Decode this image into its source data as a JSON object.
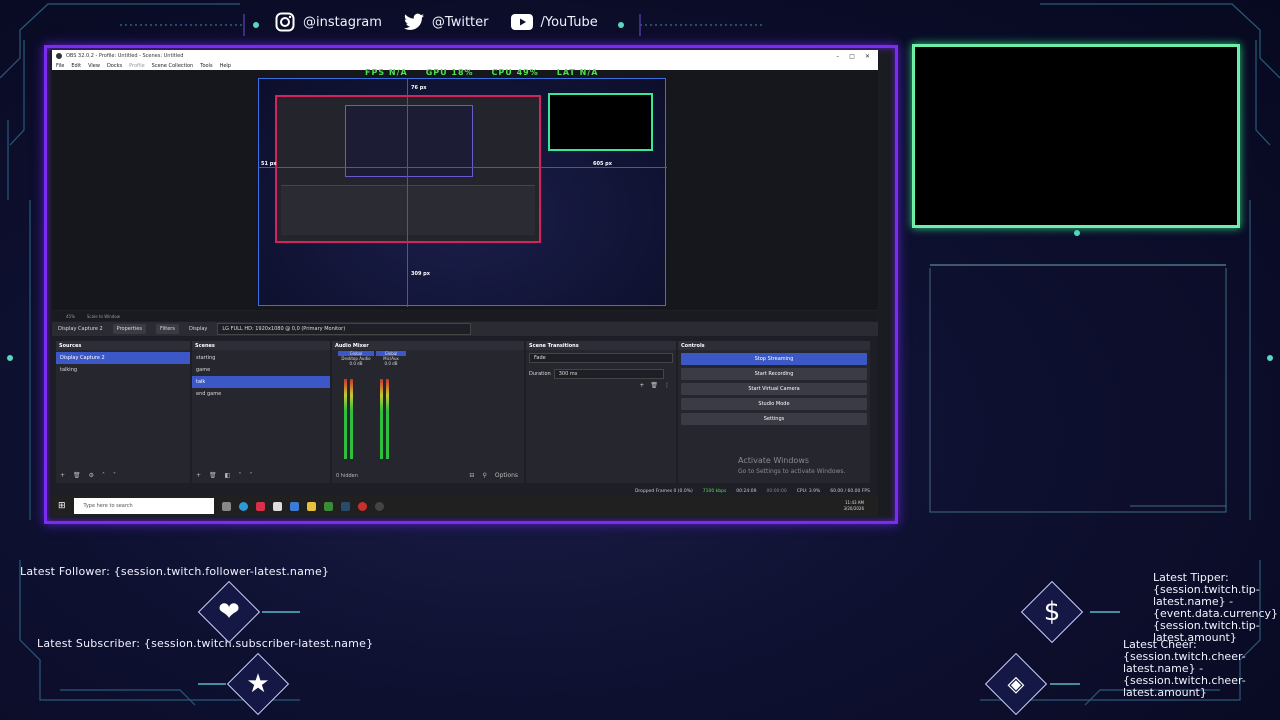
{
  "social": [
    {
      "icon": "instagram-icon",
      "label": "@instagram"
    },
    {
      "icon": "twitter-icon",
      "label": "@Twitter"
    },
    {
      "icon": "youtube-icon",
      "label": "/YouTube"
    }
  ],
  "obs": {
    "title": "OBS 32.0.2 - Profile: Untitled - Scenes: Untitled",
    "window_controls": [
      "–",
      "□",
      "✕"
    ],
    "menu": [
      "File",
      "Edit",
      "View",
      "Docks",
      "Profile",
      "Scene Collection",
      "Tools",
      "Help"
    ],
    "preview": {
      "stats": [
        "FPS N/A",
        "GPU 18%",
        "CPU 49%",
        "LAT N/A"
      ],
      "dim_top": "76 px",
      "dim_left": "51 px",
      "dim_right": "605 px",
      "dim_bottom": "309 px"
    },
    "preview_bar": [
      "45%",
      "Scale to Window"
    ],
    "source_bar": {
      "source": "Display Capture 2",
      "properties": "Properties",
      "filters": "Filters",
      "display_label": "Display",
      "display_value": "LG FULL HD: 1920x1080 @ 0,0 (Primary Monitor)"
    },
    "sources": {
      "title": "Sources",
      "items": [
        {
          "label": "Display Capture 2",
          "selected": true
        },
        {
          "label": "talking",
          "selected": false
        }
      ]
    },
    "scenes": {
      "title": "Scenes",
      "items": [
        {
          "label": "starting",
          "selected": false
        },
        {
          "label": "game",
          "selected": false
        },
        {
          "label": "talk",
          "selected": true
        },
        {
          "label": "end game",
          "selected": false
        }
      ]
    },
    "mixer": {
      "title": "Audio Mixer",
      "channels": [
        {
          "global": "Global",
          "name": "Desktop Audio",
          "db": "0.0 dB"
        },
        {
          "global": "Global",
          "name": "Mic/Aux",
          "db": "0.0 dB"
        }
      ],
      "hidden": "0 hidden"
    },
    "transitions": {
      "title": "Scene Transitions",
      "type": "Fade",
      "duration_label": "Duration",
      "duration_value": "300 ms"
    },
    "controls": {
      "title": "Controls",
      "buttons": [
        "Stop Streaming",
        "Start Recording",
        "Start Virtual Camera",
        "Studio Mode",
        "Settings"
      ],
      "options": "Options"
    },
    "activate": {
      "title": "Activate Windows",
      "sub": "Go to Settings to activate Windows."
    },
    "status": [
      "Dropped Frames 0 (0.0%)",
      "7100 kbps",
      "00:24:09",
      "00:00:00",
      "CPU: 3.9%",
      "60.00 / 60.00 FPS"
    ],
    "taskbar": {
      "search_placeholder": "Type here to search",
      "time": "11:43 AM",
      "date": "3/20/2026"
    }
  },
  "alerts": {
    "follower": "Latest Follower: {session.twitch.follower-latest.name}",
    "subscriber": "Latest Subscriber: {session.twitch.subscriber-latest.name}",
    "tipper": "Latest Tipper: {session.twitch.tip-latest.name} - {event.data.currency} {session.twitch.tip-latest.amount}",
    "cheer": "Latest Cheer: {session.twitch.cheer-latest.name} - {session.twitch.cheer-latest.amount}"
  },
  "colors": {
    "capture_border": "#7b2cf0",
    "cam_border": "#6cf0a8",
    "background": "#0e1030",
    "obs_accent": "#3b58c6"
  }
}
